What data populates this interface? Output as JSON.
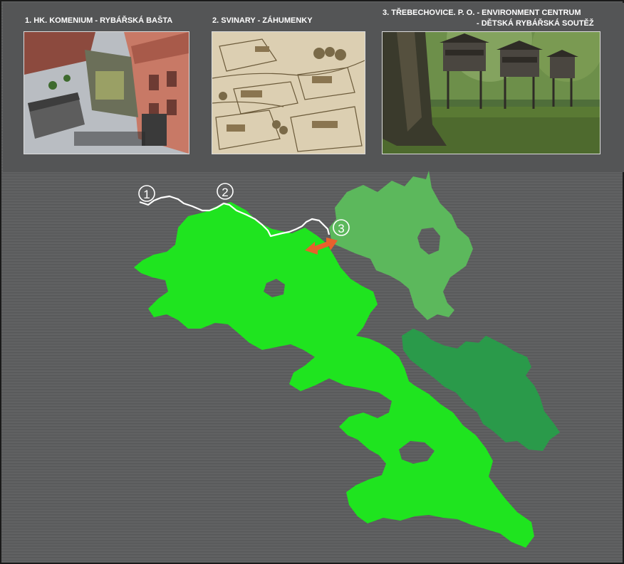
{
  "captions": {
    "c1": "1. HK. KOMENIUM - RYBÁŘSKÁ BAŠTA",
    "c2": "2. SVINARY - ZÁHUMENKY",
    "c3_line1": "3. TŘEBECHOVICE. P. O. - ENVIRONMENT CENTRUM",
    "c3_line2": "- DĚTSKÁ RYBÁŘSKÁ SOUTĚŽ"
  },
  "markers": [
    "1",
    "2",
    "3"
  ],
  "colors": {
    "background": "#5b5c5d",
    "region_main": "#1fe41f",
    "region_light": "#5cb85c",
    "region_dark": "#2a9a4a",
    "route": "#ffffff",
    "arrow": "#e8612c"
  },
  "icons": {
    "arrow": "double-headed-arrow-icon"
  }
}
